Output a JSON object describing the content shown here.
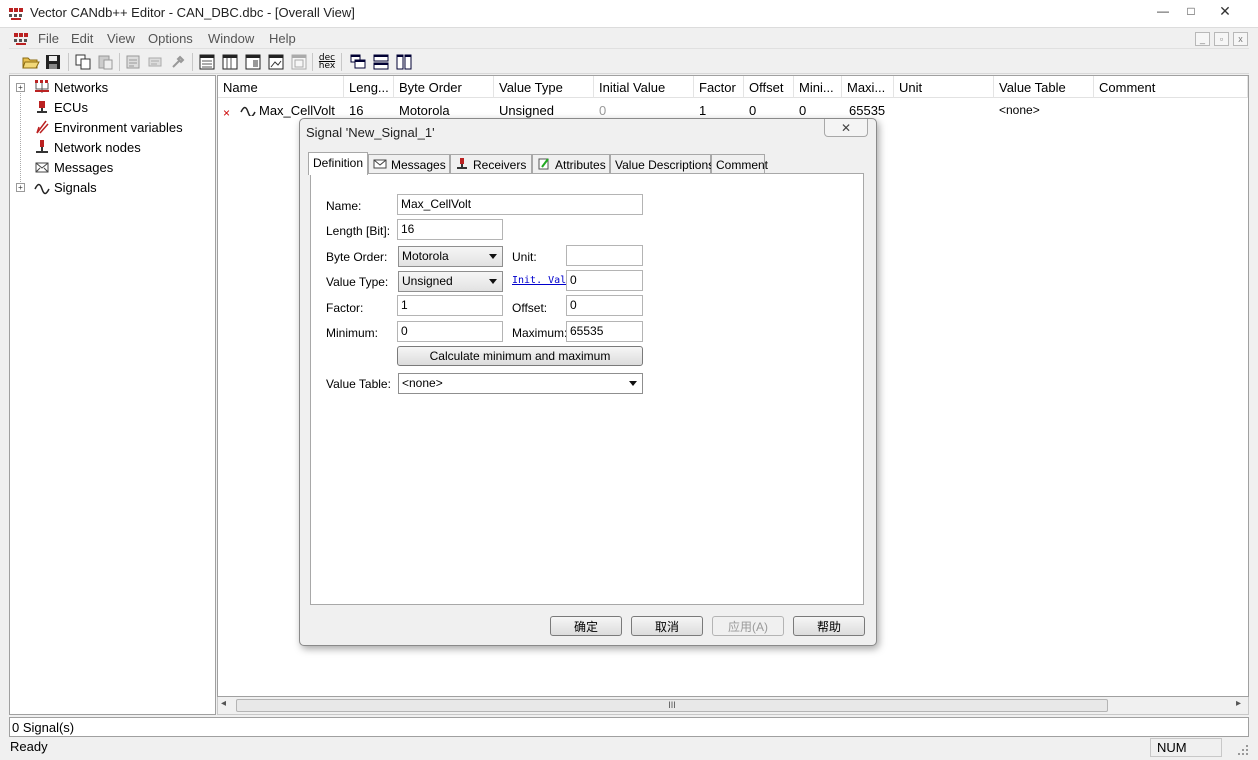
{
  "window": {
    "title": "Vector CANdb++ Editor - CAN_DBC.dbc - [Overall View]",
    "min_glyph": "—",
    "max_glyph": "□",
    "close_glyph": "✕"
  },
  "menu": [
    "File",
    "Edit",
    "View",
    "Options",
    "Window",
    "Help"
  ],
  "mdi_buttons": [
    "_",
    "▫",
    "x"
  ],
  "toolbar": {
    "dec_hex_top": "dec",
    "dec_hex_bottom": "hex"
  },
  "tree": {
    "items": [
      {
        "label": "Networks",
        "icon": "networks-icon",
        "expander": "+"
      },
      {
        "label": "ECUs",
        "icon": "ecu-icon",
        "expander": ""
      },
      {
        "label": "Environment variables",
        "icon": "env-var-icon",
        "expander": ""
      },
      {
        "label": "Network nodes",
        "icon": "network-node-icon",
        "expander": ""
      },
      {
        "label": "Messages",
        "icon": "message-icon",
        "expander": ""
      },
      {
        "label": "Signals",
        "icon": "signal-icon",
        "expander": "+"
      }
    ]
  },
  "table": {
    "columns": [
      "Name",
      "Leng...",
      "Byte Order",
      "Value Type",
      "Initial Value",
      "Factor",
      "Offset",
      "Mini...",
      "Maxi...",
      "Unit",
      "Value Table",
      "Comment"
    ],
    "rows": [
      {
        "marker": "×",
        "name": "Max_CellVolt",
        "length": "16",
        "byte_order": "Motorola",
        "value_type": "Unsigned",
        "initial_value": "0",
        "factor": "1",
        "offset": "0",
        "minimum": "0",
        "maximum": "65535",
        "unit": "",
        "value_table": "<none>",
        "comment": ""
      }
    ]
  },
  "hscroll": {
    "thumb_grip": "III",
    "left_arrow": "◂",
    "right_arrow": "▸"
  },
  "status": {
    "count": "0 Signal(s)",
    "state": "Ready",
    "num": "NUM"
  },
  "dialog": {
    "title": "Signal 'New_Signal_1'",
    "close_glyph": "✕",
    "tabs": [
      "Definition",
      "Messages",
      "Receivers",
      "Attributes",
      "Value Descriptions",
      "Comment"
    ],
    "active_tab": "Definition",
    "fields": {
      "name_label": "Name:",
      "name_value": "Max_CellVolt",
      "length_label": "Length [Bit]:",
      "length_value": "16",
      "byte_order_label": "Byte Order:",
      "byte_order_value": "Motorola",
      "unit_label": "Unit:",
      "unit_value": "",
      "value_type_label": "Value Type:",
      "value_type_value": "Unsigned",
      "init_label": "Init. Val",
      "init_value": "0",
      "factor_label": "Factor:",
      "factor_value": "1",
      "offset_label": "Offset:",
      "offset_value": "0",
      "minimum_label": "Minimum:",
      "minimum_value": "0",
      "maximum_label": "Maximum:",
      "maximum_value": "65535",
      "calc_button": "Calculate minimum and maximum",
      "value_table_label": "Value Table:",
      "value_table_value": "<none>"
    },
    "buttons": {
      "ok": "确定",
      "cancel": "取消",
      "apply": "应用(A)",
      "help": "帮助"
    }
  }
}
